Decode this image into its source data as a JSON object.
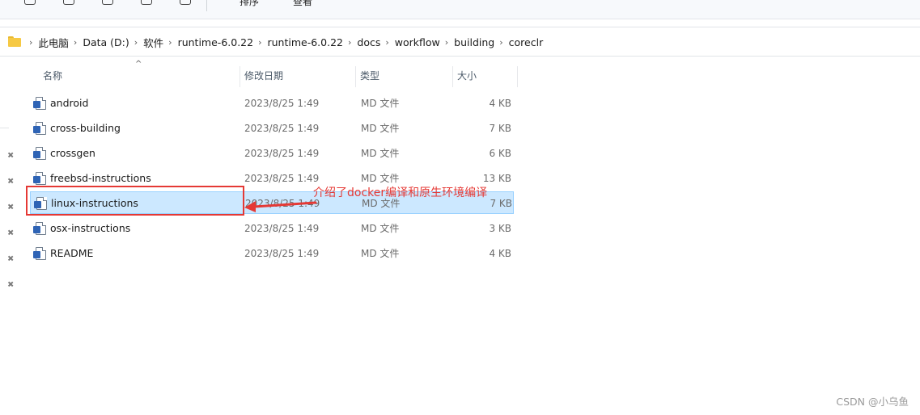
{
  "toolbar": {
    "sort_label": "排序",
    "view_label": "查看"
  },
  "address_bar": {
    "crumbs": [
      "此电脑",
      "Data (D:)",
      "软件",
      "runtime-6.0.22",
      "runtime-6.0.22",
      "docs",
      "workflow",
      "building",
      "coreclr"
    ],
    "separator": "›"
  },
  "columns": {
    "name": "名称",
    "modified": "修改日期",
    "type": "类型",
    "size": "大小",
    "sort_indicator": "^"
  },
  "files": [
    {
      "name": "android",
      "modified": "2023/8/25 1:49",
      "type": "MD 文件",
      "size": "4 KB"
    },
    {
      "name": "cross-building",
      "modified": "2023/8/25 1:49",
      "type": "MD 文件",
      "size": "7 KB"
    },
    {
      "name": "crossgen",
      "modified": "2023/8/25 1:49",
      "type": "MD 文件",
      "size": "6 KB"
    },
    {
      "name": "freebsd-instructions",
      "modified": "2023/8/25 1:49",
      "type": "MD 文件",
      "size": "13 KB"
    },
    {
      "name": "linux-instructions",
      "modified": "2023/8/25 1:49",
      "type": "MD 文件",
      "size": "7 KB",
      "selected": true
    },
    {
      "name": "osx-instructions",
      "modified": "2023/8/25 1:49",
      "type": "MD 文件",
      "size": "3 KB"
    },
    {
      "name": "README",
      "modified": "2023/8/25 1:49",
      "type": "MD 文件",
      "size": "4 KB"
    }
  ],
  "annotation": {
    "text": "介绍了docker编译和原生环境编译",
    "color": "#e53935"
  },
  "colors": {
    "selection_bg": "#cce8ff",
    "selection_border": "#99d1ff",
    "folder_yellow": "#f6c944",
    "doc_badge_blue": "#2f64b5"
  },
  "watermark": "CSDN @小乌鱼"
}
